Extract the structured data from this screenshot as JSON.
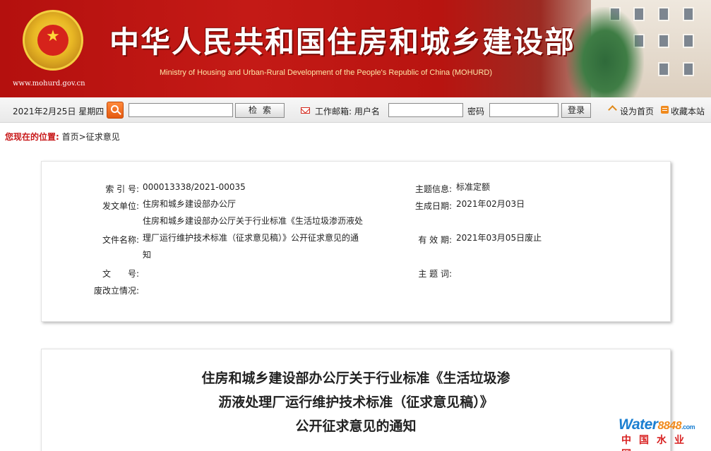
{
  "banner": {
    "title": "中华人民共和国住房和城乡建设部",
    "subtitle": "Ministry of Housing and Urban-Rural Development of the People's Republic of China (MOHURD)",
    "url": "www.mohurd.gov.cn"
  },
  "topbar": {
    "date": "2021年2月25日 星期四",
    "search_placeholder": "",
    "search_button": "检索",
    "mail_label": "工作邮箱: 用户名",
    "username_value": "",
    "password_label": "密码",
    "password_value": "",
    "login_button": "登录",
    "set_home": "设为首页",
    "favorite": "收藏本站"
  },
  "location": {
    "label": "您现在的位置:",
    "path": "首页>征求意见"
  },
  "info": {
    "index_label": "索 引 号:",
    "index_value": "000013338/2021-00035",
    "issuer_label": "发文单位:",
    "issuer_value": "住房和城乡建设部办公厅",
    "docname_label": "文件名称:",
    "docname_value": "住房和城乡建设部办公厅关于行业标准《生活垃圾渗沥液处理厂运行维护技术标准（征求意见稿）》公开征求意见的通知",
    "docno_label": "文　　号:",
    "docno_value": "",
    "status_label": "废改立情况:",
    "status_value": "",
    "topic_label": "主题信息:",
    "topic_value": "标准定额",
    "date_label": "生成日期:",
    "date_value": "2021年02月03日",
    "valid_label": "有 效 期:",
    "valid_value": "2021年03月05日废止",
    "keywords_label": "主 题 词:",
    "keywords_value": ""
  },
  "article": {
    "title_line1": "住房和城乡建设部办公厅关于行业标准《生活垃圾渗",
    "title_line2": "沥液处理厂运行维护技术标准（征求意见稿）》",
    "title_line3": "公开征求意见的通知"
  },
  "watermark": {
    "brand_word": "Water",
    "brand_number": "8848",
    "brand_suffix": ".com",
    "brand_cn": "中国水业网"
  },
  "colors": {
    "banner_red": "#c41a16",
    "location_label": "#c8191a",
    "search_orange": "#e55a10",
    "watermark_blue": "#1b7fd1",
    "watermark_red": "#d82020"
  }
}
